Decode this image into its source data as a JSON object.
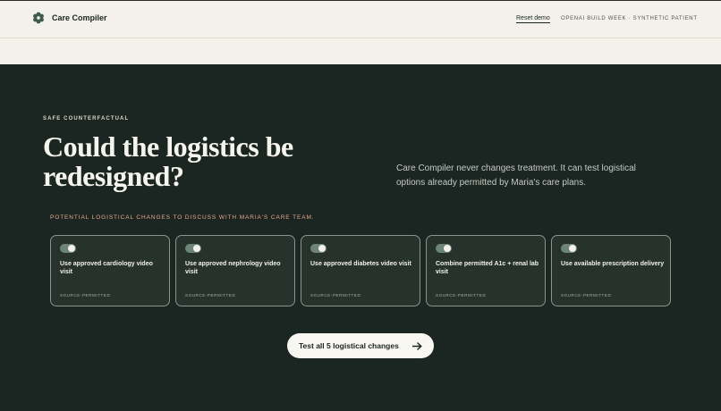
{
  "header": {
    "brand": "Care Compiler",
    "reset_label": "Reset demo",
    "tagline": "OPENAI BUILD WEEK · SYNTHETIC PATIENT"
  },
  "hero": {
    "eyebrow": "SAFE COUNTERFACTUAL",
    "headline": "Could the logistics be redesigned?",
    "lede": "Care Compiler never changes treatment. It can test logistical options already permitted by Maria's care plans."
  },
  "changes": {
    "label": "POTENTIAL LOGISTICAL CHANGES TO DISCUSS WITH MARIA'S CARE TEAM.",
    "items": [
      {
        "title": "Use approved cardiology video visit",
        "source": "SOURCE-PERMITTED",
        "enabled": true
      },
      {
        "title": "Use approved nephrology video visit",
        "source": "SOURCE-PERMITTED",
        "enabled": true
      },
      {
        "title": "Use approved diabetes video visit",
        "source": "SOURCE-PERMITTED",
        "enabled": true
      },
      {
        "title": "Combine permitted A1c + renal lab visit",
        "source": "SOURCE-PERMITTED",
        "enabled": true
      },
      {
        "title": "Use available prescription delivery",
        "source": "SOURCE-PERMITTED",
        "enabled": true
      }
    ]
  },
  "cta": {
    "label": "Test all 5 logistical changes",
    "icon": "arrow-right-icon"
  },
  "colors": {
    "dark_bg": "#1b2521",
    "light_bg": "#f3f1ea",
    "accent": "#e7a98e",
    "toggle": "#6d8579"
  }
}
